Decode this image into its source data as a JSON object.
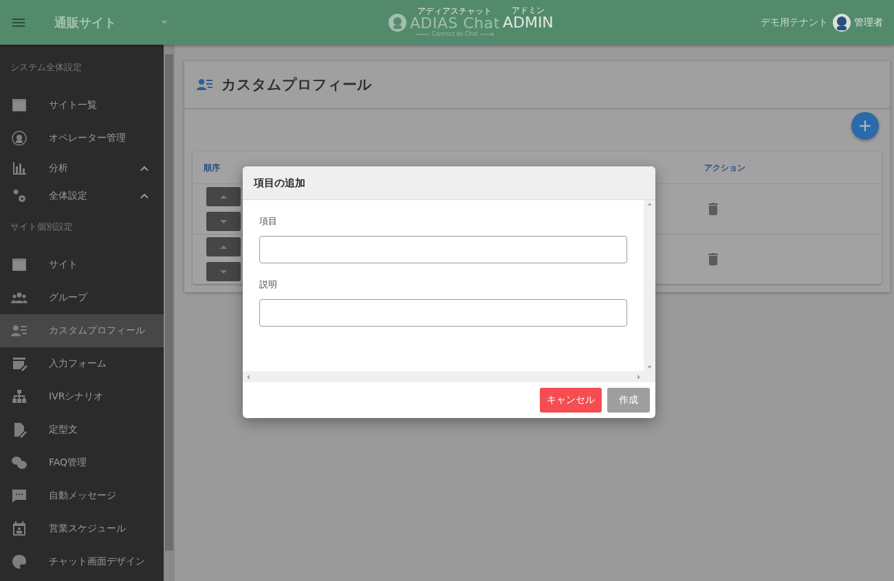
{
  "header": {
    "site_name": "通販サイト",
    "logo": {
      "ruby_left": "アディアスチャット",
      "name": "ADIAS Chat",
      "ruby_right": "アドミン",
      "suffix": "ADMIN",
      "tagline": "Connect on Chat"
    },
    "tenant": "デモ用テナント",
    "user": "管理者"
  },
  "sidebar": {
    "sections": [
      {
        "title": "システム全体設定",
        "items": [
          {
            "label": "サイト一覧",
            "selected": false
          },
          {
            "label": "オペレーター管理",
            "selected": false
          },
          {
            "label": "分析",
            "selected": false,
            "expanded": true
          },
          {
            "label": "全体設定",
            "selected": false,
            "expanded": true
          }
        ]
      },
      {
        "title": "サイト個別設定",
        "items": [
          {
            "label": "サイト",
            "selected": false
          },
          {
            "label": "グループ",
            "selected": false
          },
          {
            "label": "カスタムプロフィール",
            "selected": true
          },
          {
            "label": "入力フォーム",
            "selected": false
          },
          {
            "label": "IVRシナリオ",
            "selected": false
          },
          {
            "label": "定型文",
            "selected": false
          },
          {
            "label": "FAQ管理",
            "selected": false
          },
          {
            "label": "自動メッセージ",
            "selected": false
          },
          {
            "label": "営業スケジュール",
            "selected": false
          },
          {
            "label": "チャット画面デザイン",
            "selected": false
          }
        ]
      }
    ]
  },
  "page": {
    "title": "カスタムプロフィール",
    "table": {
      "columns": [
        "順序",
        "アクション"
      ],
      "rows": [
        {},
        {}
      ]
    }
  },
  "dialog": {
    "title": "項目の追加",
    "fields": [
      {
        "label": "項目"
      },
      {
        "label": "説明"
      }
    ],
    "buttons": [
      {
        "label": "キャンセル",
        "kind": "danger"
      },
      {
        "label": "作成",
        "kind": "primary"
      }
    ]
  }
}
